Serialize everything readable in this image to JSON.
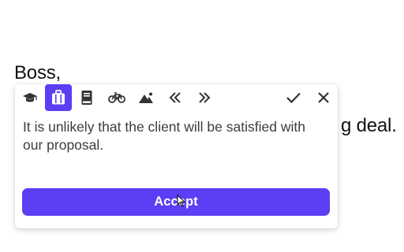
{
  "document": {
    "line1": "Boss,",
    "line2_visible_fragment": "g deal."
  },
  "popup": {
    "toolbar": {
      "tones": [
        {
          "name": "academic",
          "icon": "graduation-cap-icon",
          "active": false
        },
        {
          "name": "business",
          "icon": "briefcase-icon",
          "active": true
        },
        {
          "name": "book",
          "icon": "book-icon",
          "active": false
        },
        {
          "name": "casual",
          "icon": "bicycle-icon",
          "active": false
        },
        {
          "name": "nature",
          "icon": "mountain-icon",
          "active": false
        },
        {
          "name": "previous",
          "icon": "double-chevron-left-icon",
          "active": false
        },
        {
          "name": "next",
          "icon": "double-chevron-right-icon",
          "active": false
        }
      ],
      "confirm_icon": "check-icon",
      "close_icon": "close-icon"
    },
    "suggestion": "It is unlikely that the client will be satisfied with our proposal.",
    "accept_label": "Accept"
  },
  "colors": {
    "accent": "#5a3ff5",
    "icon": "#333333",
    "text": "#3c3c3c"
  }
}
